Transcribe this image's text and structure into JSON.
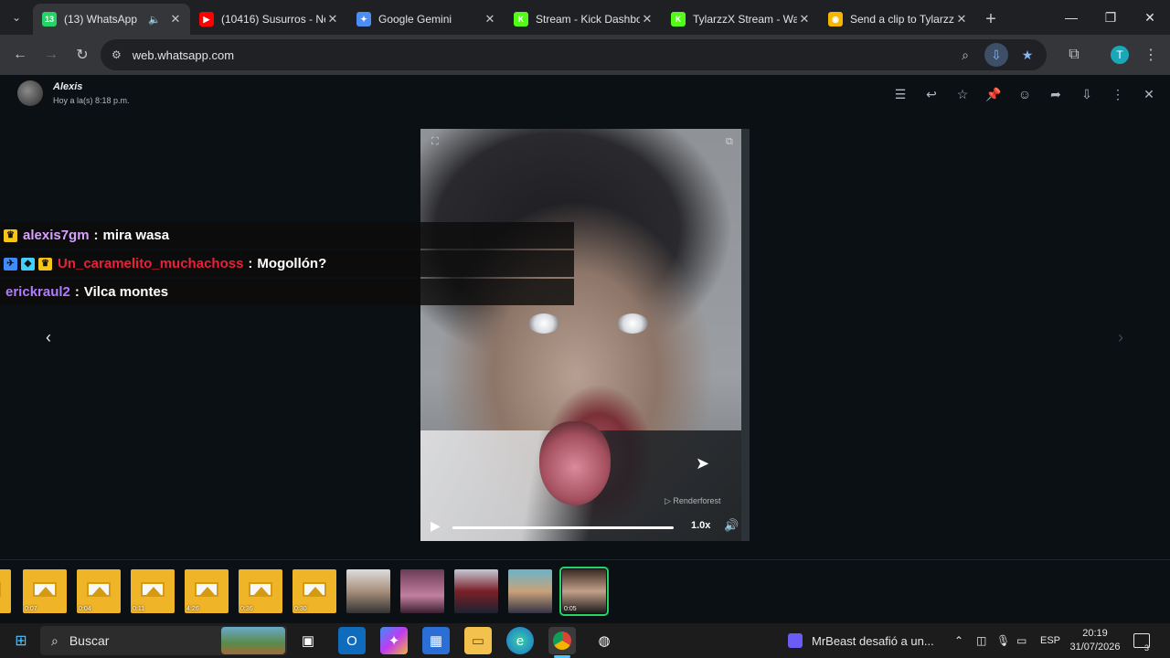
{
  "browser": {
    "tabs": [
      {
        "title": "(13) WhatsApp",
        "favicon_color": "#25d366",
        "favicon_text": "13",
        "active": true,
        "audio": true
      },
      {
        "title": "(10416) Susurros - Ne",
        "favicon_color": "#ff0000",
        "favicon_text": "▶",
        "active": false
      },
      {
        "title": "Google Gemini",
        "favicon_color": "#4c8df6",
        "favicon_text": "✦",
        "active": false
      },
      {
        "title": "Stream - Kick Dashbo",
        "favicon_color": "#53fc18",
        "favicon_text": "K",
        "active": false
      },
      {
        "title": "TylarzzX Stream - Wa",
        "favicon_color": "#53fc18",
        "favicon_text": "K",
        "active": false
      },
      {
        "title": "Send a clip to Tylarzz",
        "favicon_color": "#f7b500",
        "favicon_text": "◉",
        "active": false
      }
    ],
    "url": "web.whatsapp.com",
    "profile_initial": "T",
    "profile_color": "#1aa7b8"
  },
  "viewer": {
    "sender": "Alexis",
    "time": "Hoy a la(s) 8:18 p.m.",
    "header_icons": [
      "list-icon",
      "reply-icon",
      "star-icon",
      "pin-icon",
      "emoji-icon",
      "forward-icon",
      "download-icon",
      "more-icon",
      "close-icon"
    ],
    "video": {
      "watermark": "Renderforest",
      "speed": "1.0x",
      "progress": 0.97
    }
  },
  "chat_overlay": [
    {
      "user": "alexis7gm",
      "user_color": "#d7a1ff",
      "message": "mira wasa",
      "badges": [
        {
          "color": "#f5c518",
          "glyph": "♛"
        }
      ]
    },
    {
      "user": "Un_caramelito_muchachoss",
      "user_color": "#e8203a",
      "message": "Mogollón?",
      "badges": [
        {
          "color": "#3d8bff",
          "glyph": "✈"
        },
        {
          "color": "#3fd1ff",
          "glyph": "◆"
        },
        {
          "color": "#f5c518",
          "glyph": "♛"
        }
      ]
    },
    {
      "user": "erickraul2",
      "user_color": "#b07cff",
      "message": "Vilca montes",
      "badges": []
    }
  ],
  "thumbnails": [
    {
      "type": "image",
      "duration": ""
    },
    {
      "type": "image",
      "duration": "0:07"
    },
    {
      "type": "image",
      "duration": "0:04"
    },
    {
      "type": "image",
      "duration": "0:11"
    },
    {
      "type": "image",
      "duration": "4:26"
    },
    {
      "type": "image",
      "duration": "0:36"
    },
    {
      "type": "image",
      "duration": "0:30"
    },
    {
      "type": "photo",
      "duration": ""
    },
    {
      "type": "photo",
      "duration": ""
    },
    {
      "type": "photo",
      "duration": ""
    },
    {
      "type": "photo",
      "duration": ""
    },
    {
      "type": "photo",
      "duration": "0:05",
      "selected": true
    }
  ],
  "taskbar": {
    "search_label": "Buscar",
    "news": "MrBeast desafió a un...",
    "language": "ESP",
    "time": "20:19",
    "date": "31/07/2026",
    "notifications": "3"
  }
}
